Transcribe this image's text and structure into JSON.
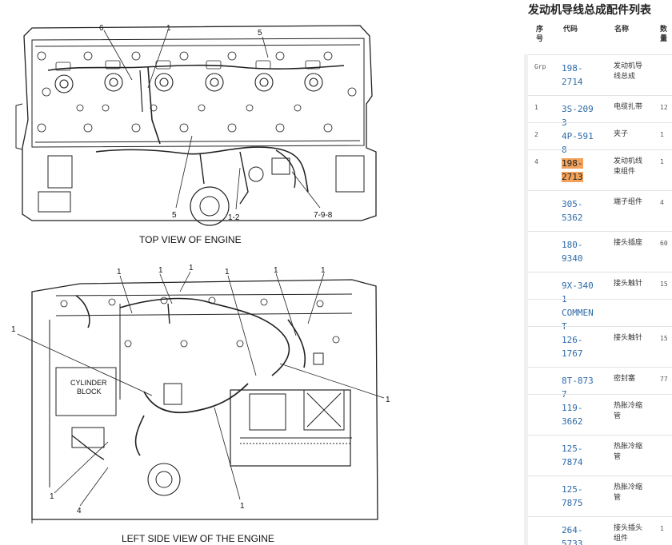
{
  "diagram": {
    "top_view_caption": "TOP VIEW OF ENGINE",
    "side_view_caption": "LEFT SIDE VIEW OF THE ENGINE",
    "cylinder_block_line1": "CYLINDER",
    "cylinder_block_line2": "BLOCK",
    "callouts_top": [
      "6",
      "1",
      "5",
      "5",
      "1-2",
      "7-9-8"
    ],
    "callouts_side": [
      "1",
      "1",
      "1",
      "1",
      "1",
      "1",
      "1",
      "1",
      "1",
      "1",
      "4",
      "1"
    ]
  },
  "panel": {
    "title": "发动机导线总成配件列表",
    "headers": {
      "seq": "序\n号",
      "code": "代码",
      "name": "名称",
      "qty": "数\n量"
    },
    "rows": [
      {
        "seq": "Grp",
        "code": "198-\n2714",
        "name": "发动机导线总成",
        "qty": ""
      },
      {
        "seq": "1",
        "code": "3S-2093",
        "name": "电缆扎带",
        "qty": "12"
      },
      {
        "seq": "2",
        "code": "4P-5918",
        "name": "夹子",
        "qty": "1"
      },
      {
        "seq": "4",
        "code": "198-\n2713",
        "name": "发动机线束组件",
        "qty": "1",
        "highlight": true
      },
      {
        "seq": "",
        "code": "305-\n5362",
        "name": "端子组件",
        "qty": "4"
      },
      {
        "seq": "",
        "code": "180-\n9340",
        "name": "接头插座",
        "qty": "60"
      },
      {
        "seq": "",
        "code": "9X-3401",
        "name": "接头触针",
        "qty": "15"
      },
      {
        "seq": "",
        "code": "COMMENT",
        "name": "",
        "qty": ""
      },
      {
        "seq": "",
        "code": "126-\n1767",
        "name": "接头触针",
        "qty": "15"
      },
      {
        "seq": "",
        "code": "8T-8737",
        "name": "密封塞",
        "qty": "77"
      },
      {
        "seq": "",
        "code": "119-\n3662",
        "name": "热胀冷缩管",
        "qty": ""
      },
      {
        "seq": "",
        "code": "125-\n7874",
        "name": "热胀冷缩管",
        "qty": ""
      },
      {
        "seq": "",
        "code": "125-\n7875",
        "name": "热胀冷缩管",
        "qty": ""
      },
      {
        "seq": "",
        "code": "264-\n5733",
        "name": "接头插头组件",
        "qty": "1"
      }
    ],
    "highlight_color": "#f2a25a",
    "link_color": "#2c6aa8"
  }
}
